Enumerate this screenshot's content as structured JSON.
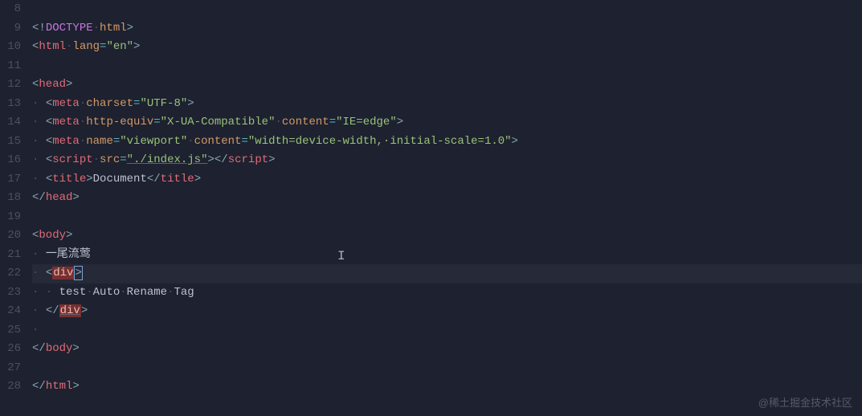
{
  "editor": {
    "startLine": 8,
    "activeLine": 22,
    "cursorLine": 21,
    "cursorColAfter": "一尾流莺",
    "watermark": "@稀土掘金技术社区",
    "lines": [
      {
        "n": 8,
        "indent": 0,
        "tokens": []
      },
      {
        "n": 9,
        "indent": 0,
        "tokens": [
          {
            "c": "br",
            "t": "<!"
          },
          {
            "c": "doctype",
            "t": "DOCTYPE"
          },
          {
            "c": "ws",
            "t": "·"
          },
          {
            "c": "attr",
            "t": "html"
          },
          {
            "c": "br",
            "t": ">"
          }
        ]
      },
      {
        "n": 10,
        "indent": 0,
        "tokens": [
          {
            "c": "br",
            "t": "<"
          },
          {
            "c": "tag",
            "t": "html"
          },
          {
            "c": "ws",
            "t": "·"
          },
          {
            "c": "attr",
            "t": "lang"
          },
          {
            "c": "op",
            "t": "="
          },
          {
            "c": "str",
            "t": "\"en\""
          },
          {
            "c": "br",
            "t": ">"
          }
        ]
      },
      {
        "n": 11,
        "indent": 0,
        "tokens": []
      },
      {
        "n": 12,
        "indent": 0,
        "tokens": [
          {
            "c": "br",
            "t": "<"
          },
          {
            "c": "tag",
            "t": "head"
          },
          {
            "c": "br",
            "t": ">"
          }
        ]
      },
      {
        "n": 13,
        "indent": 1,
        "tokens": [
          {
            "c": "br",
            "t": "<"
          },
          {
            "c": "tag",
            "t": "meta"
          },
          {
            "c": "ws",
            "t": "·"
          },
          {
            "c": "attr",
            "t": "charset"
          },
          {
            "c": "op",
            "t": "="
          },
          {
            "c": "str",
            "t": "\"UTF-8\""
          },
          {
            "c": "br",
            "t": ">"
          }
        ]
      },
      {
        "n": 14,
        "indent": 1,
        "tokens": [
          {
            "c": "br",
            "t": "<"
          },
          {
            "c": "tag",
            "t": "meta"
          },
          {
            "c": "ws",
            "t": "·"
          },
          {
            "c": "attr",
            "t": "http-equiv"
          },
          {
            "c": "op",
            "t": "="
          },
          {
            "c": "str",
            "t": "\"X-UA-Compatible\""
          },
          {
            "c": "ws",
            "t": "·"
          },
          {
            "c": "attr",
            "t": "content"
          },
          {
            "c": "op",
            "t": "="
          },
          {
            "c": "str",
            "t": "\"IE=edge\""
          },
          {
            "c": "br",
            "t": ">"
          }
        ]
      },
      {
        "n": 15,
        "indent": 1,
        "tokens": [
          {
            "c": "br",
            "t": "<"
          },
          {
            "c": "tag",
            "t": "meta"
          },
          {
            "c": "ws",
            "t": "·"
          },
          {
            "c": "attr",
            "t": "name"
          },
          {
            "c": "op",
            "t": "="
          },
          {
            "c": "str",
            "t": "\"viewport\""
          },
          {
            "c": "ws",
            "t": "·"
          },
          {
            "c": "attr",
            "t": "content"
          },
          {
            "c": "op",
            "t": "="
          },
          {
            "c": "str",
            "t": "\"width=device-width,·initial-scale=1.0\""
          },
          {
            "c": "br",
            "t": ">"
          }
        ]
      },
      {
        "n": 16,
        "indent": 1,
        "tokens": [
          {
            "c": "br",
            "t": "<"
          },
          {
            "c": "tag",
            "t": "script"
          },
          {
            "c": "ws",
            "t": "·"
          },
          {
            "c": "attr",
            "t": "src"
          },
          {
            "c": "op",
            "t": "="
          },
          {
            "c": "str underline",
            "t": "\"./index.js\""
          },
          {
            "c": "br",
            "t": "></"
          },
          {
            "c": "tag",
            "t": "script"
          },
          {
            "c": "br",
            "t": ">"
          }
        ]
      },
      {
        "n": 17,
        "indent": 1,
        "tokens": [
          {
            "c": "br",
            "t": "<"
          },
          {
            "c": "tag",
            "t": "title"
          },
          {
            "c": "br",
            "t": ">"
          },
          {
            "c": "txt",
            "t": "Document"
          },
          {
            "c": "br",
            "t": "</"
          },
          {
            "c": "tag",
            "t": "title"
          },
          {
            "c": "br",
            "t": ">"
          }
        ]
      },
      {
        "n": 18,
        "indent": 0,
        "tokens": [
          {
            "c": "br",
            "t": "</"
          },
          {
            "c": "tag",
            "t": "head"
          },
          {
            "c": "br",
            "t": ">"
          }
        ]
      },
      {
        "n": 19,
        "indent": 0,
        "tokens": []
      },
      {
        "n": 20,
        "indent": 0,
        "tokens": [
          {
            "c": "br",
            "t": "<"
          },
          {
            "c": "tag",
            "t": "body"
          },
          {
            "c": "br",
            "t": ">"
          }
        ]
      },
      {
        "n": 21,
        "indent": 1,
        "tokens": [
          {
            "c": "txt",
            "t": "一尾流莺"
          }
        ]
      },
      {
        "n": 22,
        "indent": 1,
        "tokens": [
          {
            "c": "br",
            "t": "<"
          },
          {
            "c": "hl-tag",
            "t": "div"
          },
          {
            "c": "br cursor-box",
            "t": ">"
          }
        ]
      },
      {
        "n": 23,
        "indent": 2,
        "tokens": [
          {
            "c": "txt",
            "t": "test"
          },
          {
            "c": "ws",
            "t": "·"
          },
          {
            "c": "txt",
            "t": "Auto"
          },
          {
            "c": "ws",
            "t": "·"
          },
          {
            "c": "txt",
            "t": "Rename"
          },
          {
            "c": "ws",
            "t": "·"
          },
          {
            "c": "txt",
            "t": "Tag"
          }
        ]
      },
      {
        "n": 24,
        "indent": 1,
        "tokens": [
          {
            "c": "br",
            "t": "</"
          },
          {
            "c": "hl-tag underline",
            "t": "div"
          },
          {
            "c": "br",
            "t": ">"
          }
        ]
      },
      {
        "n": 25,
        "indent": 1,
        "tokens": []
      },
      {
        "n": 26,
        "indent": 0,
        "tokens": [
          {
            "c": "br",
            "t": "</"
          },
          {
            "c": "tag",
            "t": "body"
          },
          {
            "c": "br",
            "t": ">"
          }
        ]
      },
      {
        "n": 27,
        "indent": 0,
        "tokens": []
      },
      {
        "n": 28,
        "indent": 0,
        "tokens": [
          {
            "c": "br",
            "t": "</"
          },
          {
            "c": "tag",
            "t": "html"
          },
          {
            "c": "br",
            "t": ">"
          }
        ]
      }
    ]
  }
}
